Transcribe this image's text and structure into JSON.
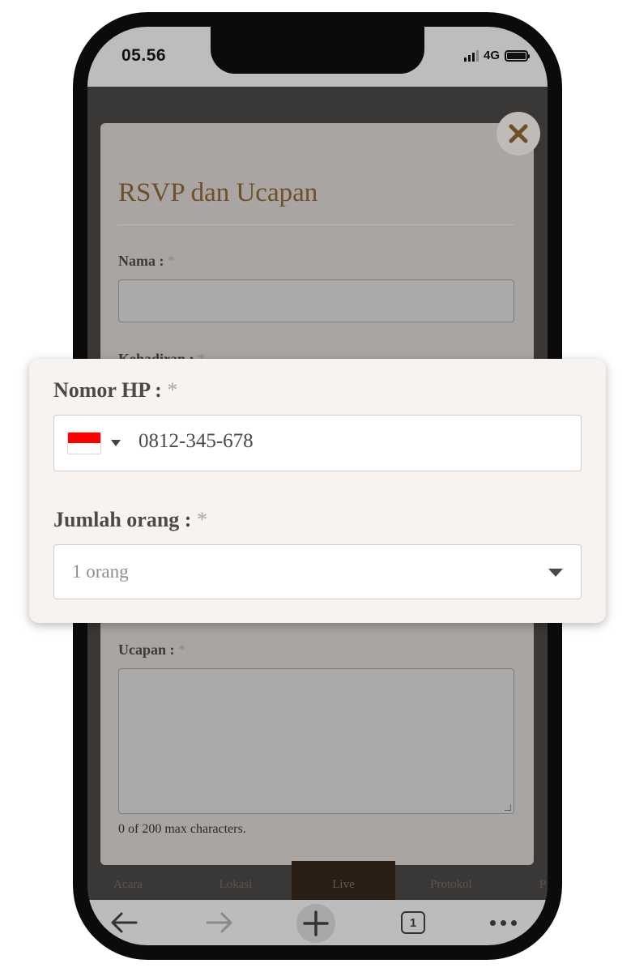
{
  "status_bar": {
    "time": "05.56",
    "network": "4G"
  },
  "modal": {
    "title": "RSVP dan Ucapan",
    "required_mark": "*",
    "fields": {
      "name_label": "Nama :",
      "attendance_label": "Kehadiran :",
      "message_label": "Ucapan :"
    },
    "char_counter": "0 of 200 max characters."
  },
  "zoom_card": {
    "phone_label": "Nomor HP :",
    "phone_value": "0812-345-678",
    "people_label": "Jumlah orang :",
    "people_selected": "1 orang"
  },
  "bottom_nav": {
    "items": [
      {
        "label": "Acara"
      },
      {
        "label": "Lokasi"
      },
      {
        "label": "Live"
      },
      {
        "label": "Protokol"
      },
      {
        "label": "P"
      }
    ]
  },
  "browser": {
    "tab_count": "1"
  },
  "colors": {
    "title_brown": "#6e4f27",
    "close_x": "#6e4f27",
    "flag_red": "#ff0000",
    "nav_active": "#2a1d14"
  }
}
